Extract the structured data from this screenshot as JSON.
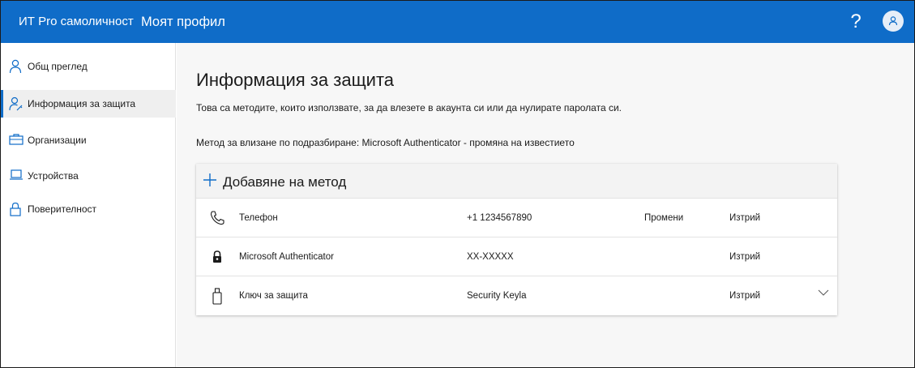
{
  "header": {
    "org_name": "ИТ Pro самоличност",
    "app_name": "Моят профил",
    "help_label": "?",
    "accent_color": "#0f6cc8",
    "icons": [
      "help-icon",
      "user-avatar-icon"
    ]
  },
  "sidebar": {
    "items": [
      {
        "label": "Общ преглед",
        "icon": "person-icon",
        "active": false
      },
      {
        "label": "Информация за защита",
        "icon": "person-key-icon",
        "active": true
      },
      {
        "label": "Организации",
        "icon": "briefcase-icon",
        "active": false
      },
      {
        "label": "Устройства",
        "icon": "laptop-icon",
        "active": false
      },
      {
        "label": "Поверителност",
        "icon": "lock-icon",
        "active": false
      }
    ]
  },
  "main": {
    "title": "Информация за защита",
    "description": "Това са методите, които използвате, за да влезете в акаунта си или да нулирате паролата си.",
    "default_method": "Метод за влизане по подразбиране: Microsoft Authenticator - промяна на известието",
    "add_method_label": "Добавяне на метод",
    "methods": [
      {
        "name": "Телефон",
        "detail": "+1 1234567890",
        "change": "Промени",
        "delete": "Изтрий",
        "icon": "phone-icon"
      },
      {
        "name": "Microsoft Authenticator",
        "detail": "XX-XXXXX",
        "change": "",
        "delete": "Изтрий",
        "icon": "authenticator-lock-icon"
      },
      {
        "name": "Ключ за защита",
        "detail": "Security Keyla",
        "change": "",
        "delete": "Изтрий",
        "icon": "usb-key-icon"
      }
    ]
  }
}
